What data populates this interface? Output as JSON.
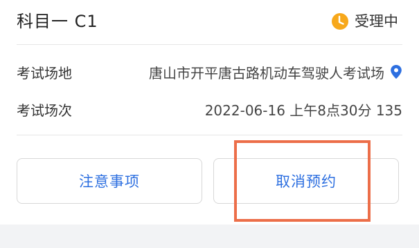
{
  "card": {
    "subject_title": "科目一 C1",
    "status": {
      "icon": "clock-icon",
      "text": "受理中",
      "color": "#f7a81b"
    },
    "rows": [
      {
        "label": "考试场地",
        "value": "唐山市开平唐古路机动车驾驶人考试场",
        "icon": "location-pin-icon"
      },
      {
        "label": "考试场次",
        "value": "2022-06-16 上午8点30分 135"
      }
    ],
    "buttons": {
      "notes_label": "注意事项",
      "cancel_label": "取消预约"
    }
  },
  "colors": {
    "accent_blue": "#2d6fe0",
    "highlight_orange": "#ec6e49",
    "background": "#f2f3f5"
  }
}
